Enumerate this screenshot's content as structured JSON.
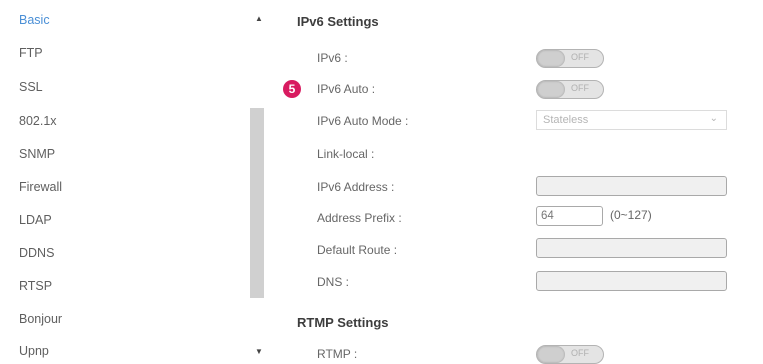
{
  "sidebar": {
    "items": [
      {
        "label": "Basic"
      },
      {
        "label": "FTP"
      },
      {
        "label": "SSL"
      },
      {
        "label": "802.1x"
      },
      {
        "label": "SNMP"
      },
      {
        "label": "Firewall"
      },
      {
        "label": "LDAP"
      },
      {
        "label": "DDNS"
      },
      {
        "label": "RTSP"
      },
      {
        "label": "Bonjour"
      },
      {
        "label": "Upnp"
      }
    ],
    "active_item": "Basic",
    "scroll_up_icon": "triangle-up",
    "scroll_down_icon": "triangle-down"
  },
  "ipv6": {
    "title": "IPv6 Settings",
    "ipv6_label": "IPv6 :",
    "ipv6_toggle": "OFF",
    "auto_label": "IPv6 Auto :",
    "auto_toggle": "OFF",
    "auto_badge": "5",
    "mode_label": "IPv6 Auto Mode :",
    "mode_value": "Stateless",
    "link_local_label": "Link-local :",
    "address_label": "IPv6 Address :",
    "address_value": "",
    "prefix_label": "Address Prefix :",
    "prefix_value": "64",
    "prefix_range": "(0~127)",
    "route_label": "Default Route :",
    "route_value": "",
    "dns_label": "DNS :",
    "dns_value": ""
  },
  "rtmp": {
    "title": "RTMP Settings",
    "rtmp_label": "RTMP :",
    "rtmp_toggle": "OFF"
  },
  "colors": {
    "active_link": "#4a8fd6",
    "badge": "#d81b60",
    "toggle_off": "#e4e4e4"
  }
}
